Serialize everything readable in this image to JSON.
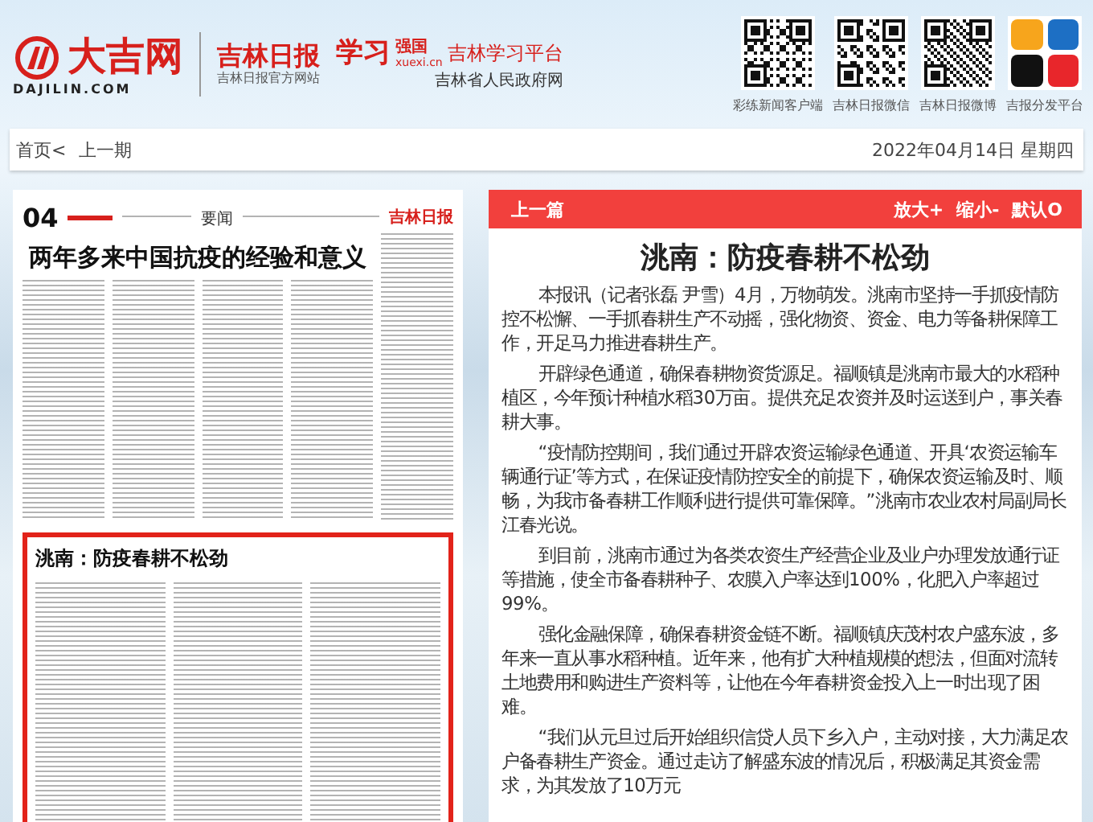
{
  "header": {
    "site_logo": {
      "name": "大吉网",
      "domain": "DAJILIN.COM"
    },
    "paper_logo": {
      "name": "吉林日报",
      "caption": "吉林日报官方网站"
    },
    "xuexi_logo": {
      "name_a": "学习",
      "name_b": "强国",
      "domain": "xuexi.cn",
      "platform": "吉林学习平台",
      "caption": "吉林省人民政府网"
    },
    "qr_codes": [
      {
        "label": "彩练新闻客户端"
      },
      {
        "label": "吉林日报微信"
      },
      {
        "label": "吉林日报微博"
      }
    ],
    "apps_label": "吉报分发平台"
  },
  "nav": {
    "home": "首页<",
    "prev_issue": "上一期",
    "date": "2022年04月14日 星期四"
  },
  "newspaper": {
    "page_number": "04",
    "section": "要闻",
    "masthead": "吉林日报",
    "headline": "两年多来中国抗疫的经验和意义",
    "selected_article": {
      "headline": "洮南：防疫春耕不松劲",
      "selected": true
    }
  },
  "article": {
    "prev": "上一篇",
    "controls": [
      "放大+",
      "缩小-",
      "默认O"
    ],
    "title": "洮南：防疫春耕不松劲",
    "paragraphs": [
      "本报讯（记者张磊 尹雪）4月，万物萌发。洮南市坚持一手抓疫情防控不松懈、一手抓春耕生产不动摇，强化物资、资金、电力等备耕保障工作，开足马力推进春耕生产。",
      "开辟绿色通道，确保春耕物资货源足。福顺镇是洮南市最大的水稻种植区，今年预计种植水稻30万亩。提供充足农资并及时运送到户，事关春耕大事。",
      "“疫情防控期间，我们通过开辟农资运输绿色通道、开具‘农资运输车辆通行证’等方式，在保证疫情防控安全的前提下，确保农资运输及时、顺畅，为我市备春耕工作顺利进行提供可靠保障。”洮南市农业农村局副局长江春光说。",
      "到目前，洮南市通过为各类农资生产经营企业及业户办理发放通行证等措施，使全市备春耕种子、农膜入户率达到100%，化肥入户率超过99%。",
      "强化金融保障，确保春耕资金链不断。福顺镇庆茂村农户盛东波，多年来一直从事水稻种植。近年来，他有扩大种植规模的想法，但面对流转土地费用和购进生产资料等，让他在今年春耕资金投入上一时出现了困难。",
      "“我们从元旦过后开始组织信贷人员下乡入户，主动对接，大力满足农户备春耕生产资金。通过走访了解盛东波的情况后，积极满足其资金需求，为其发放了10万元"
    ]
  }
}
